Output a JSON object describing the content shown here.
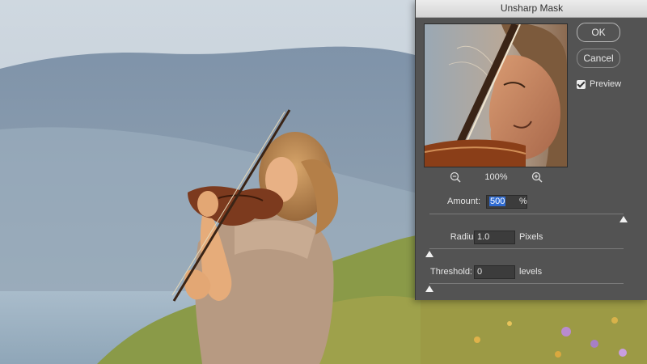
{
  "dialog": {
    "title": "Unsharp Mask",
    "ok_label": "OK",
    "cancel_label": "Cancel",
    "preview_label": "Preview",
    "preview_checked": true,
    "zoom_level": "100%",
    "amount": {
      "label": "Amount:",
      "value": "500",
      "unit": "%",
      "slider_fraction": 1.0
    },
    "radius": {
      "label": "Radius:",
      "value": "1.0",
      "unit": "Pixels",
      "slider_fraction": 0.0
    },
    "threshold": {
      "label": "Threshold:",
      "value": "0",
      "unit": "levels",
      "slider_fraction": 0.0
    }
  },
  "icons": {
    "zoom_out": "zoom-out-icon",
    "zoom_in": "zoom-in-icon",
    "checkbox": "checkmark-icon"
  },
  "colors": {
    "dialog_bg": "#535353",
    "input_bg": "#3c3c3c",
    "selection": "#2f6bd1"
  }
}
